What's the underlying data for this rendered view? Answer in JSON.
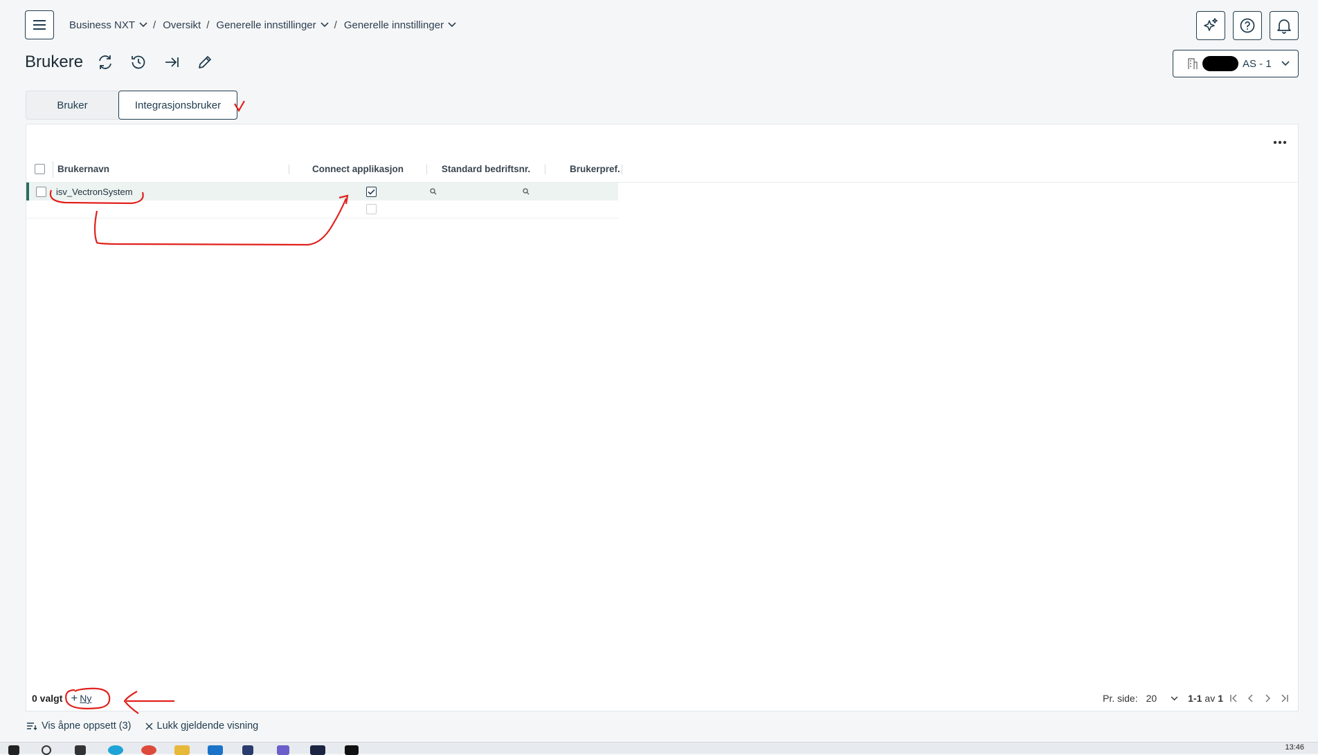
{
  "breadcrumb": [
    {
      "label": "Business NXT",
      "dropdown": true
    },
    {
      "label": "Oversikt",
      "dropdown": false
    },
    {
      "label": "Generelle innstillinger",
      "dropdown": true
    },
    {
      "label": "Generelle innstillinger",
      "dropdown": true
    }
  ],
  "page": {
    "title": "Brukere"
  },
  "company": {
    "label": "AS - 1"
  },
  "tabs": [
    {
      "label": "Bruker",
      "active": false
    },
    {
      "label": "Integrasjonsbruker",
      "active": true
    }
  ],
  "grid": {
    "columns": [
      "Brukernavn",
      "Connect applikasjon",
      "Standard bedriftsnr.",
      "Brukerpref."
    ],
    "rows": [
      {
        "username": "isv_VectronSystem",
        "connect": true
      },
      {
        "username": "",
        "connect": false
      }
    ]
  },
  "footer": {
    "selected": "0 valgt",
    "new_label": "Ny",
    "per_page_label": "Pr. side:",
    "per_page_value": "20",
    "range": "1-1",
    "of_label": "av",
    "total": "1"
  },
  "bottom": {
    "show_open": "Vis åpne oppsett (3)",
    "close_view": "Lukk gjeldende visning"
  },
  "taskbar": {
    "clock": "13:46"
  },
  "colors": {
    "primary": "#1f3b4d",
    "selected_row": "#ecf3f1",
    "annotation": "#e0201b"
  }
}
